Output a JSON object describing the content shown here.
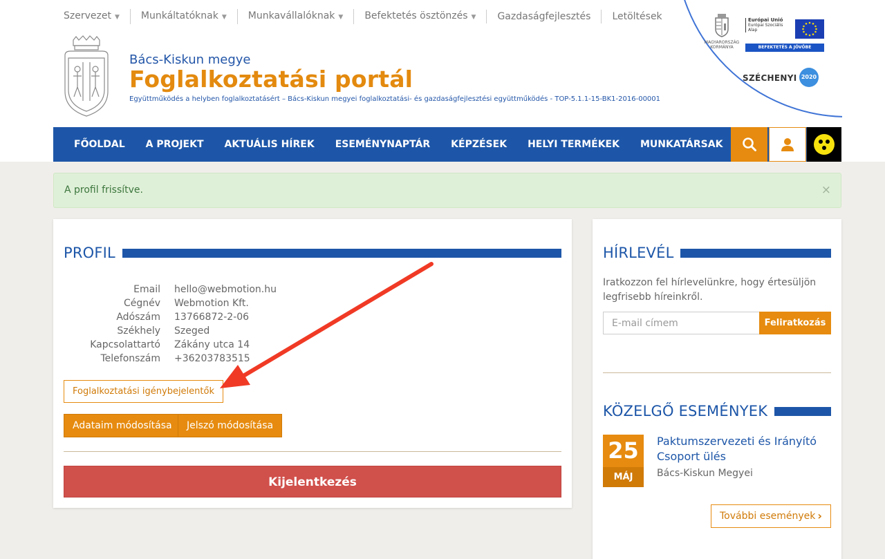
{
  "top_menu": [
    {
      "label": "Szervezet",
      "has_dropdown": true
    },
    {
      "label": "Munkáltatóknak",
      "has_dropdown": true
    },
    {
      "label": "Munkavállalóknak",
      "has_dropdown": true
    },
    {
      "label": "Befektetés ösztönzés",
      "has_dropdown": true
    },
    {
      "label": "Gazdaságfejlesztés",
      "has_dropdown": false
    },
    {
      "label": "Letöltések",
      "has_dropdown": false
    }
  ],
  "branding": {
    "county": "Bács-Kiskun megye",
    "title": "Foglalkoztatási portál",
    "description": "Együttműködés a helyben foglalkoztatásért – Bács-Kiskun megyei foglalkoztatási- és gazdaságfejlesztési együttműködés - TOP-5.1.1-15-BK1-2016-00001"
  },
  "eu_badge": {
    "gov_line1": "MAGYARORSZÁG",
    "gov_line2": "KORMÁNYA",
    "eu_line1": "Európai Unió",
    "eu_line2": "Európai Szociális",
    "eu_line3": "Alap",
    "strip": "BEFEKTETÉS A JÖVŐBE",
    "szechenyi": "SZÉCHENYI",
    "year": "2020"
  },
  "main_nav": [
    "FŐOLDAL",
    "A PROJEKT",
    "AKTUÁLIS HÍREK",
    "ESEMÉNYNAPTÁR",
    "KÉPZÉSEK",
    "HELYI TERMÉKEK",
    "MUNKATÁRSAK"
  ],
  "alert": {
    "text": "A profil frissítve.",
    "close": "×"
  },
  "profile": {
    "title": "PROFIL",
    "fields": [
      {
        "label": "Email",
        "value": "hello@webmotion.hu"
      },
      {
        "label": "Cégnév",
        "value": "Webmotion Kft."
      },
      {
        "label": "Adószám",
        "value": "13766872-2-06"
      },
      {
        "label": "Székhely",
        "value": "Szeged"
      },
      {
        "label": "Kapcsolattartó",
        "value": "Zákány utca 14"
      },
      {
        "label": "Telefonszám",
        "value": "+36203783515"
      }
    ],
    "requests_button": "Foglalkoztatási igénybejelentők",
    "edit_button": "Adataim módosítása",
    "password_button": "Jelszó módosítása",
    "logout_button": "Kijelentkezés"
  },
  "newsletter": {
    "title": "HÍRLEVÉL",
    "text": "Iratkozzon fel hírlevelünkre, hogy értesüljön legfrisebb híreinkről.",
    "placeholder": "E-mail címem",
    "button": "Feliratkozás"
  },
  "events": {
    "title": "KÖZELGŐ ESEMÉNYEK",
    "items": [
      {
        "day": "25",
        "month": "MÁJ",
        "title": "Paktumszervezeti és Irányító Csoport ülés",
        "location": "Bács-Kiskun Megyei"
      }
    ],
    "more_button": "További események"
  },
  "colors": {
    "blue": "#1d56a8",
    "orange": "#e68b0f",
    "red": "#d0504b",
    "success_bg": "#dff0d8"
  },
  "icons": [
    "search-icon",
    "user-icon",
    "accessibility-icon",
    "close-icon",
    "chevron-right-icon",
    "caret-down-icon"
  ]
}
